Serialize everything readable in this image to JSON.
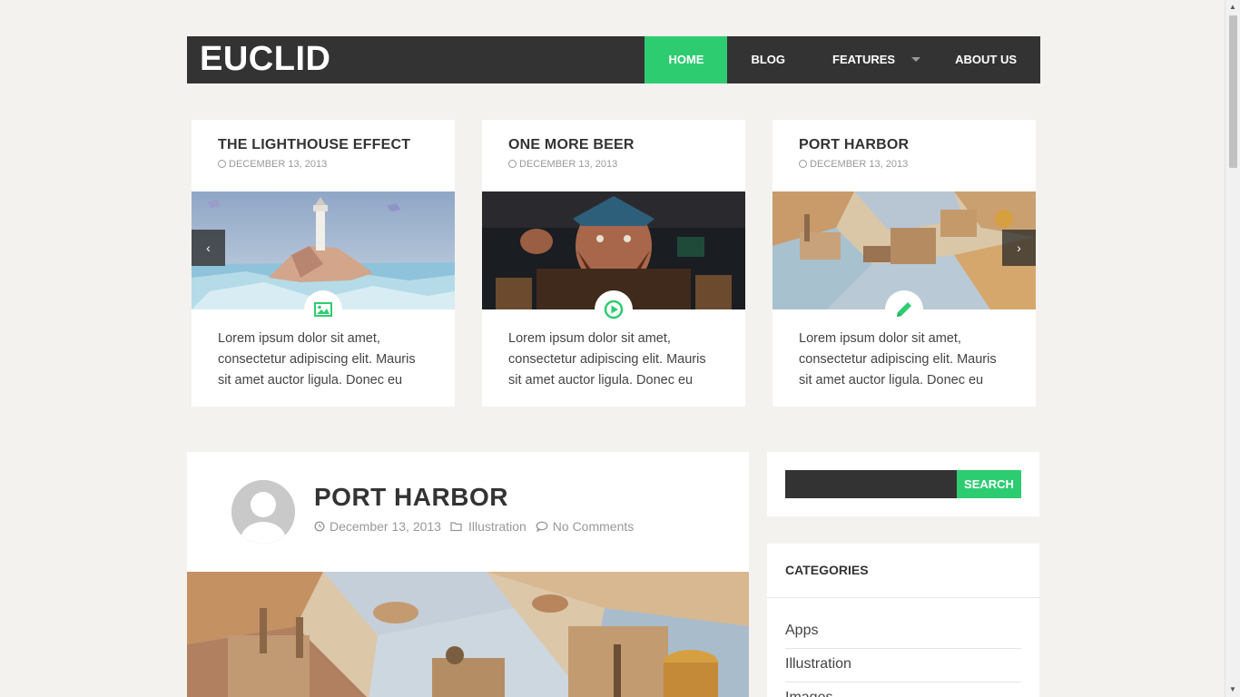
{
  "site": {
    "logo": "EUCLID"
  },
  "nav": {
    "items": [
      {
        "label": "HOME",
        "active": true
      },
      {
        "label": "BLOG",
        "active": false
      },
      {
        "label": "FEATURES",
        "active": false,
        "has_dropdown": true
      },
      {
        "label": "ABOUT US",
        "active": false
      }
    ]
  },
  "slider": {
    "prev_icon": "chevron-left-icon",
    "next_icon": "chevron-right-icon",
    "cards": [
      {
        "title": "THE LIGHTHOUSE EFFECT",
        "date": "DECEMBER 13, 2013",
        "format_icon": "image-icon",
        "excerpt": "Lorem ipsum dolor sit amet, consectetur adipiscing elit. Mauris sit amet auctor ligula. Donec eu"
      },
      {
        "title": "ONE MORE BEER",
        "date": "DECEMBER 13, 2013",
        "format_icon": "play-circle-icon",
        "excerpt": "Lorem ipsum dolor sit amet, consectetur adipiscing elit. Mauris sit amet auctor ligula. Donec eu"
      },
      {
        "title": "PORT HARBOR",
        "date": "DECEMBER 13, 2013",
        "format_icon": "pencil-icon",
        "excerpt": "Lorem ipsum dolor sit amet, consectetur adipiscing elit. Mauris sit amet auctor ligula. Donec eu"
      }
    ]
  },
  "post": {
    "title": "PORT HARBOR",
    "date": "December 13, 2013",
    "category": "Illustration",
    "comments": "No Comments"
  },
  "search": {
    "placeholder": "",
    "button_label": "SEARCH"
  },
  "categories": {
    "title": "CATEGORIES",
    "items": [
      "Apps",
      "Illustration",
      "Images"
    ]
  },
  "colors": {
    "accent": "#2ecc71",
    "header_bg": "#333333",
    "page_bg": "#f3f2ef"
  }
}
